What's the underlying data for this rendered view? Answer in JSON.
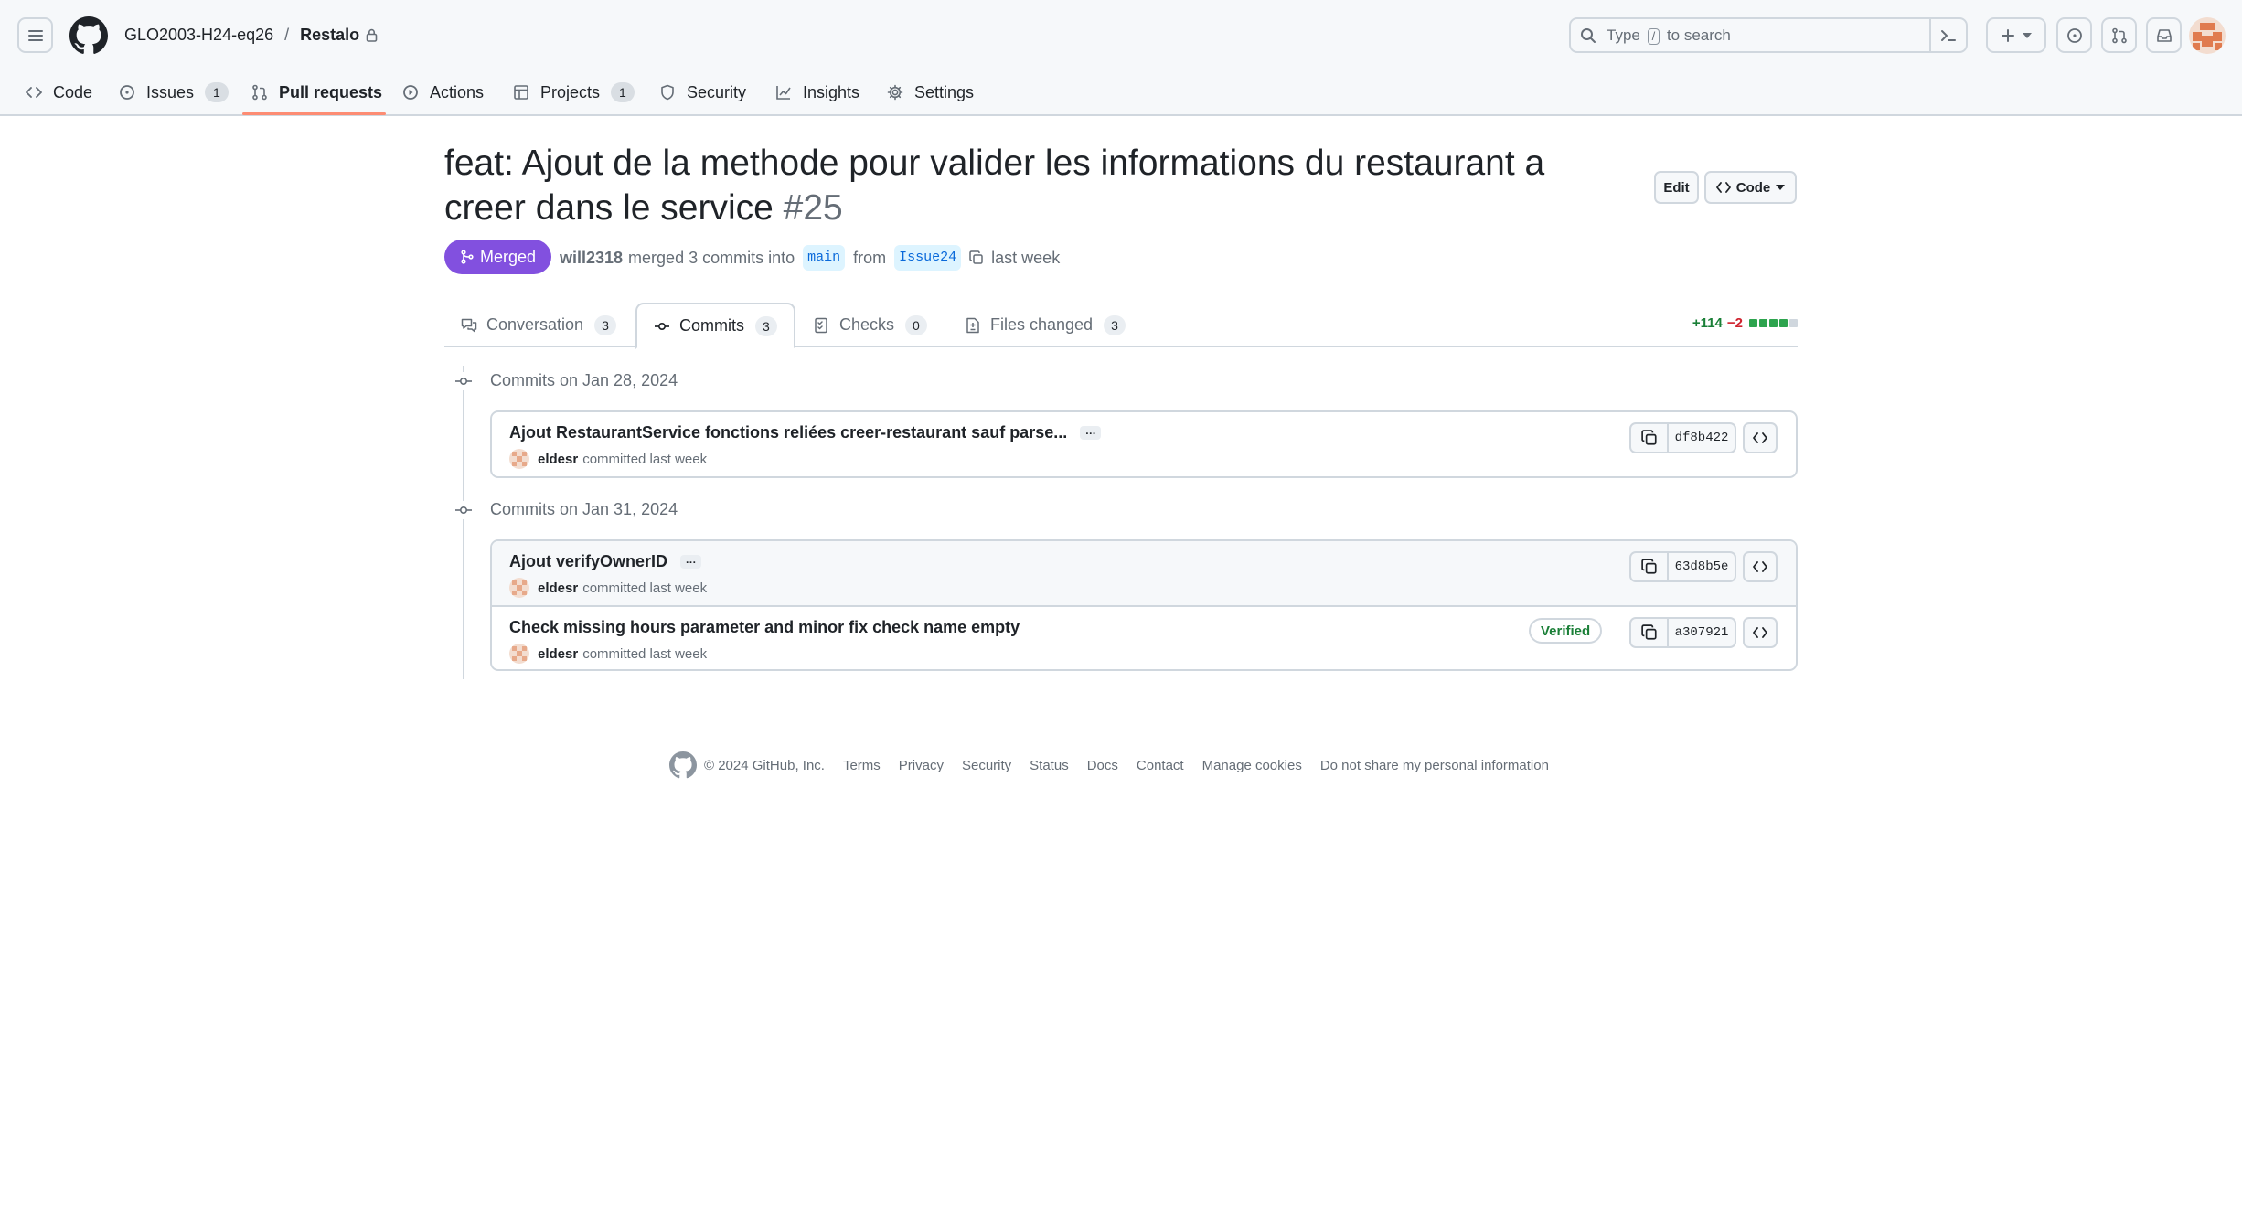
{
  "header": {
    "org": "GLO2003-H24-eq26",
    "separator": "/",
    "repo": "Restalo",
    "search_prefix": "Type",
    "search_key": "/",
    "search_suffix": "to search"
  },
  "repo_nav": {
    "items": [
      {
        "label": "Code",
        "icon": "code-icon"
      },
      {
        "label": "Issues",
        "icon": "issue-opened-icon",
        "count": "1"
      },
      {
        "label": "Pull requests",
        "icon": "git-pull-request-icon",
        "active": true
      },
      {
        "label": "Actions",
        "icon": "play-icon"
      },
      {
        "label": "Projects",
        "icon": "table-icon",
        "count": "1"
      },
      {
        "label": "Security",
        "icon": "shield-icon"
      },
      {
        "label": "Insights",
        "icon": "graph-icon"
      },
      {
        "label": "Settings",
        "icon": "gear-icon"
      }
    ]
  },
  "pr": {
    "title": "feat: Ajout de la methode pour valider les informations du restaurant a creer dans le service",
    "number": "#25",
    "edit_label": "Edit",
    "code_label": "Code",
    "status": "Merged",
    "author": "will2318",
    "merged_text": "merged 3 commits into",
    "base_branch": "main",
    "from_text": "from",
    "head_branch": "Issue24",
    "when": "last week"
  },
  "tabs": [
    {
      "label": "Conversation",
      "count": "3",
      "icon": "comment-discussion-icon"
    },
    {
      "label": "Commits",
      "count": "3",
      "icon": "git-commit-icon",
      "active": true
    },
    {
      "label": "Checks",
      "count": "0",
      "icon": "checklist-icon"
    },
    {
      "label": "Files changed",
      "count": "3",
      "icon": "file-diff-icon"
    }
  ],
  "diffstat": {
    "additions": "+114",
    "deletions": "−2"
  },
  "commit_groups": [
    {
      "date_label": "Commits on Jan 28, 2024",
      "commits": [
        {
          "message": "Ajout RestaurantService fonctions reliées creer-restaurant sauf parse...",
          "author": "eldesr",
          "meta": "committed last week",
          "sha": "df8b422",
          "verified": false
        }
      ]
    },
    {
      "date_label": "Commits on Jan 31, 2024",
      "commits": [
        {
          "message": "Ajout verifyOwnerID",
          "author": "eldesr",
          "meta": "committed last week",
          "sha": "63d8b5e",
          "verified": false
        },
        {
          "message": "Check missing hours parameter and minor fix check name empty",
          "author": "eldesr",
          "meta": "committed last week",
          "sha": "a307921",
          "verified": true,
          "verified_label": "Verified"
        }
      ]
    }
  ],
  "footer": {
    "copyright": "© 2024 GitHub, Inc.",
    "links": [
      "Terms",
      "Privacy",
      "Security",
      "Status",
      "Docs",
      "Contact",
      "Manage cookies",
      "Do not share my personal information"
    ]
  },
  "colors": {
    "merged": "#8250df",
    "accent_underline": "#fd8c73",
    "add": "#1a7f37",
    "del": "#cf222e",
    "link": "#0969da"
  }
}
